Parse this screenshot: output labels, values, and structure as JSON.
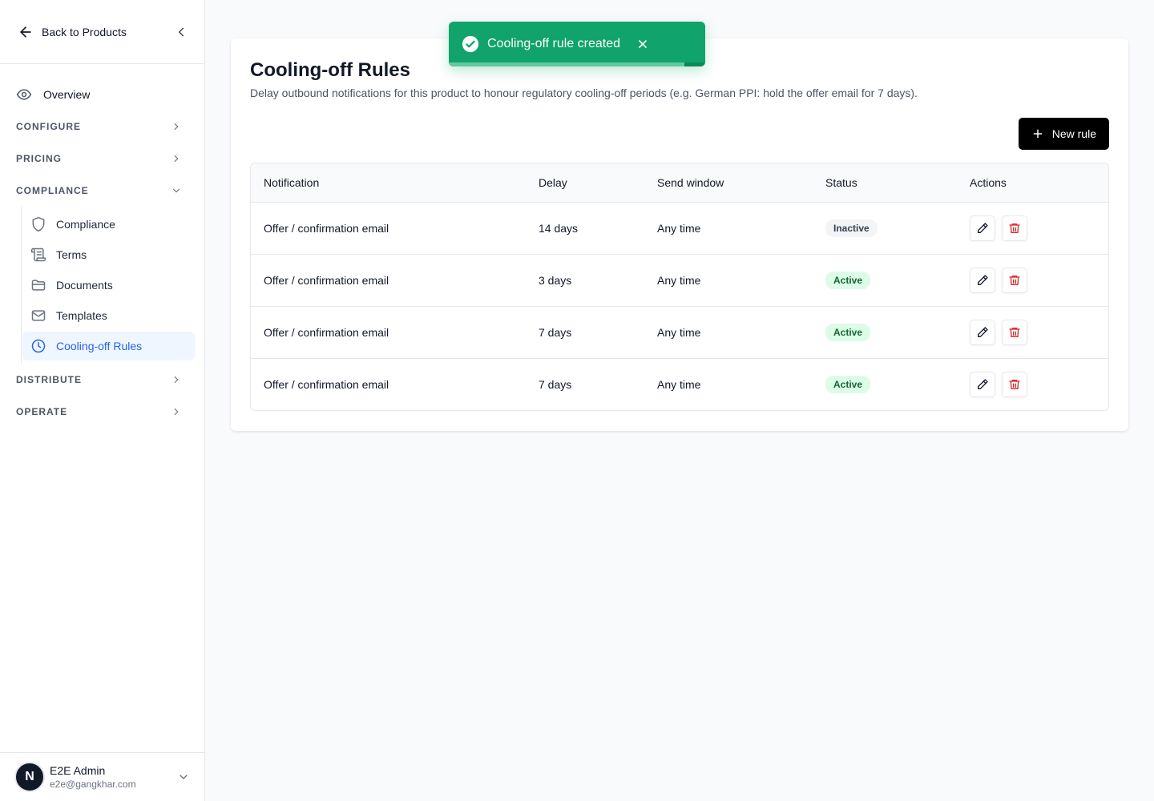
{
  "sidebar": {
    "back_label": "Back to Products",
    "overview_label": "Overview",
    "groups": [
      {
        "label": "CONFIGURE",
        "expanded": false
      },
      {
        "label": "PRICING",
        "expanded": false
      },
      {
        "label": "COMPLIANCE",
        "expanded": true
      },
      {
        "label": "DISTRIBUTE",
        "expanded": false
      },
      {
        "label": "OPERATE",
        "expanded": false
      }
    ],
    "compliance_items": [
      {
        "label": "Compliance",
        "icon": "shield-icon"
      },
      {
        "label": "Terms",
        "icon": "scroll-icon"
      },
      {
        "label": "Documents",
        "icon": "folder-icon"
      },
      {
        "label": "Templates",
        "icon": "mail-icon"
      },
      {
        "label": "Cooling-off Rules",
        "icon": "clock-icon",
        "active": true
      }
    ],
    "user": {
      "initial": "N",
      "name": "E2E Admin",
      "email": "e2e@gangkhar.com"
    }
  },
  "page": {
    "title": "Cooling-off Rules",
    "description": "Delay outbound notifications for this product to honour regulatory cooling-off periods (e.g. German PPI: hold the offer email for 7 days).",
    "new_rule_label": "New rule"
  },
  "table": {
    "columns": [
      "Notification",
      "Delay",
      "Send window",
      "Status",
      "Actions"
    ],
    "rows": [
      {
        "notification": "Offer / confirmation email",
        "delay": "14 days",
        "window": "Any time",
        "status": "Inactive"
      },
      {
        "notification": "Offer / confirmation email",
        "delay": "3 days",
        "window": "Any time",
        "status": "Active"
      },
      {
        "notification": "Offer / confirmation email",
        "delay": "7 days",
        "window": "Any time",
        "status": "Active"
      },
      {
        "notification": "Offer / confirmation email",
        "delay": "7 days",
        "window": "Any time",
        "status": "Active"
      }
    ]
  },
  "toast": {
    "message": "Cooling-off rule created",
    "progress": 0.92
  },
  "colors": {
    "accent": "#2563eb",
    "toast": "#10a36b",
    "danger": "#dc2626",
    "active_badge": "#dcfce7"
  }
}
